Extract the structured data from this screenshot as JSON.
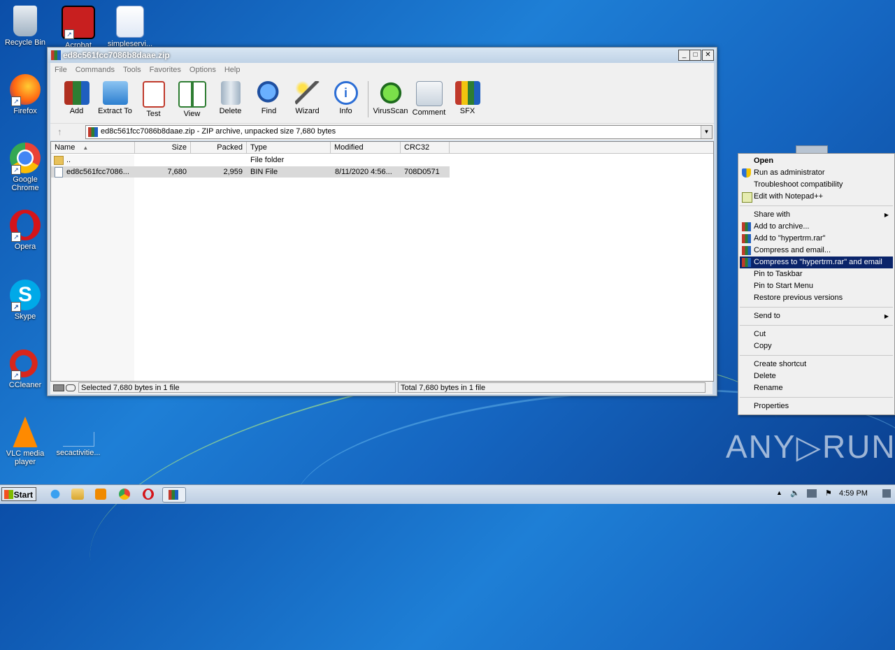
{
  "desktop": {
    "icons": [
      {
        "label": "Recycle Bin"
      },
      {
        "label": "Acrobat"
      },
      {
        "label": "simpleservi..."
      },
      {
        "label": "Firefox"
      },
      {
        "label": "Google Chrome"
      },
      {
        "label": "Opera"
      },
      {
        "label": "Skype"
      },
      {
        "label": "CCleaner"
      },
      {
        "label": "VLC media player"
      },
      {
        "label": "secactivitie..."
      }
    ]
  },
  "window": {
    "title": "ed8c561fcc7086b8daae.zip",
    "minimize": "_",
    "maximize": "□",
    "close": "✕",
    "menu": [
      "File",
      "Commands",
      "Tools",
      "Favorites",
      "Options",
      "Help"
    ],
    "toolbar": [
      "Add",
      "Extract To",
      "Test",
      "View",
      "Delete",
      "Find",
      "Wizard",
      "Info",
      "VirusScan",
      "Comment",
      "SFX"
    ],
    "address": "ed8c561fcc7086b8daae.zip - ZIP archive, unpacked size 7,680 bytes",
    "columns": [
      "Name",
      "Size",
      "Packed",
      "Type",
      "Modified",
      "CRC32"
    ],
    "rows": [
      {
        "name": "..",
        "size": "",
        "packed": "",
        "type": "File folder",
        "modified": "",
        "crc": ""
      },
      {
        "name": "ed8c561fcc7086...",
        "size": "7,680",
        "packed": "2,959",
        "type": "BIN File",
        "modified": "8/11/2020 4:56...",
        "crc": "708D0571"
      }
    ],
    "status_left": "Selected 7,680 bytes in 1 file",
    "status_right": "Total 7,680 bytes in 1 file"
  },
  "context_menu": {
    "items": [
      "Open",
      "Run as administrator",
      "Troubleshoot compatibility",
      "Edit with Notepad++",
      "Share with",
      "Add to archive...",
      "Add to \"hypertrm.rar\"",
      "Compress and email...",
      "Compress to \"hypertrm.rar\" and email",
      "Pin to Taskbar",
      "Pin to Start Menu",
      "Restore previous versions",
      "Send to",
      "Cut",
      "Copy",
      "Create shortcut",
      "Delete",
      "Rename",
      "Properties"
    ]
  },
  "taskbar": {
    "start_label": "Start",
    "clock": "4:59 PM"
  },
  "watermark": "ANY▷RUN"
}
